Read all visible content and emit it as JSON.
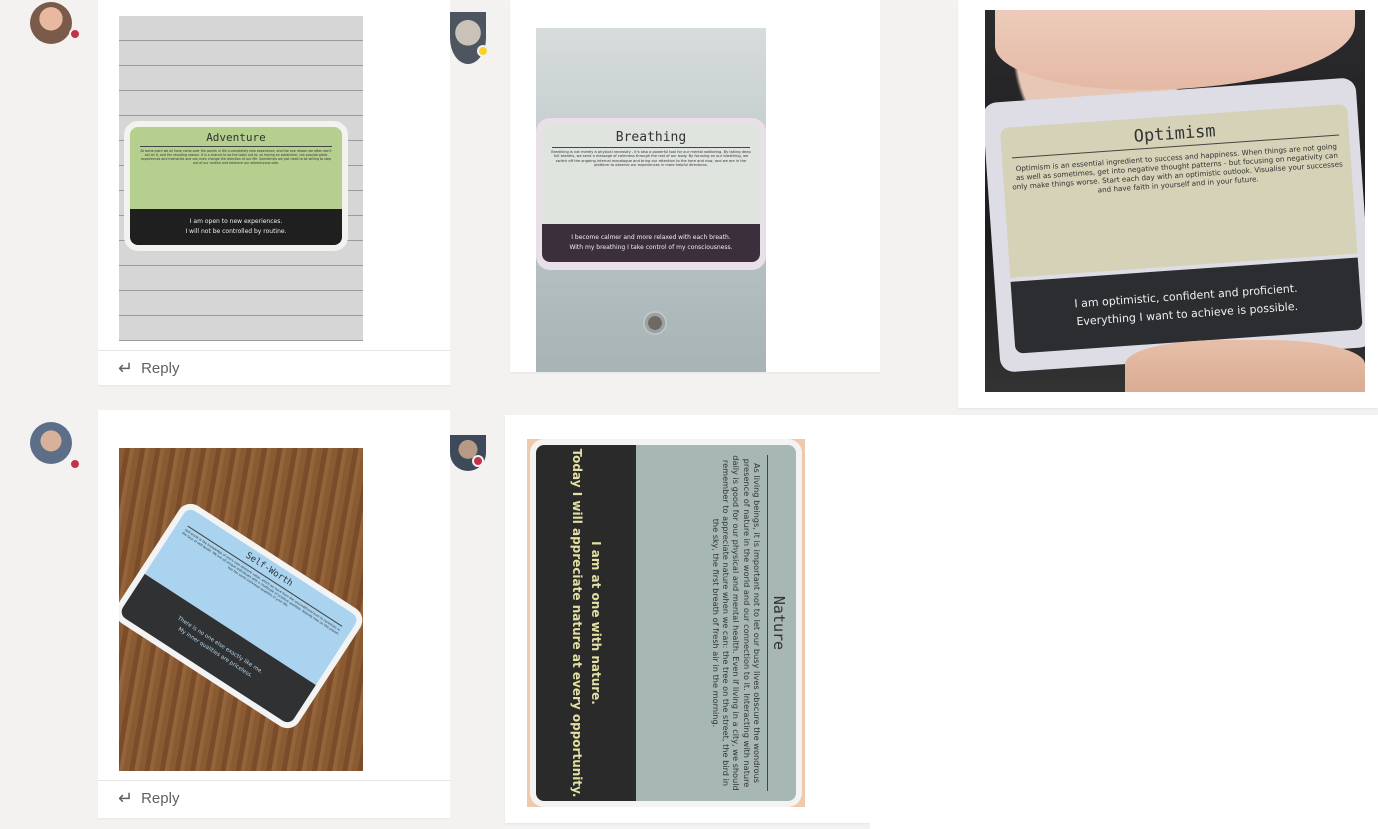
{
  "posts": [
    {
      "card": {
        "title": "Adventure",
        "body": "At some point we all have come over the points in life a completely new experience, and the one reason we often don't act on it, and the resulting reason. It is a chance to do the looks out to, so having an adventure, can provide great experiences and memories and can even change the direction of our life. Sometimes we just need to be willing to step out of our routine and embrace our adventurous side.",
        "affirmations": [
          "I am open to new experiences.",
          "I will not be controlled by routine."
        ]
      },
      "reply_label": "Reply"
    },
    {
      "card": {
        "title": "Breathing",
        "body": "Breathing is not merely a physical necessity - it's also a powerful tool for our mental wellbeing. By taking deep full breaths, we send a message of calmness through the rest of our body. By focusing on our breathing, we switch off the ongoing internal monologue and bring our attention to the here and now, and we are in the platform to observe our experiences in more helpful directions.",
        "affirmations": [
          "I become calmer and more relaxed with each breath.",
          "With my breathing I take control of my consciousness."
        ]
      }
    },
    {
      "card": {
        "title": "Optimism",
        "body": "Optimism is an essential ingredient to success and happiness. When things are not going as well as sometimes, get into negative thought patterns - but focusing on negativity can only make things worse. Start each day with an optimistic outlook. Visualise your successes and have faith in yourself and in your future.",
        "affirmations": [
          "I am optimistic, confident and proficient.",
          "Everything I want to achieve is possible."
        ]
      }
    },
    {
      "card": {
        "title": "Self-Worth",
        "body": "Self-worth is the knowledge of one's own inherent value, which we have from the unconditional love to ourselves in the face of self-doubt. We are all unique individuals with a multitude of positive qualities. Nobody else on this planet has the same individual qualities in your life.",
        "affirmations": [
          "There is no one else exactly like me.",
          "My inner qualities are priceless."
        ]
      },
      "reply_label": "Reply"
    },
    {
      "card": {
        "title": "Nature",
        "body": "As living beings, it is important not to let our busy lives obscure the wondrous presence of nature in the world and our connection to it. Interacting with nature daily is good for our physical and mental health. Even if living in a city, we should remember to appreciate nature when we can: the tree on the street, the bird in the sky, the first breath of fresh air in the morning.",
        "affirmations": [
          "I am at one with nature.",
          "Today I will appreciate nature at every opportunity."
        ]
      }
    }
  ],
  "colors": {
    "presence_busy": "#c4314b",
    "presence_away": "#f8d22a",
    "panel_bg": "#f3f2f1"
  }
}
